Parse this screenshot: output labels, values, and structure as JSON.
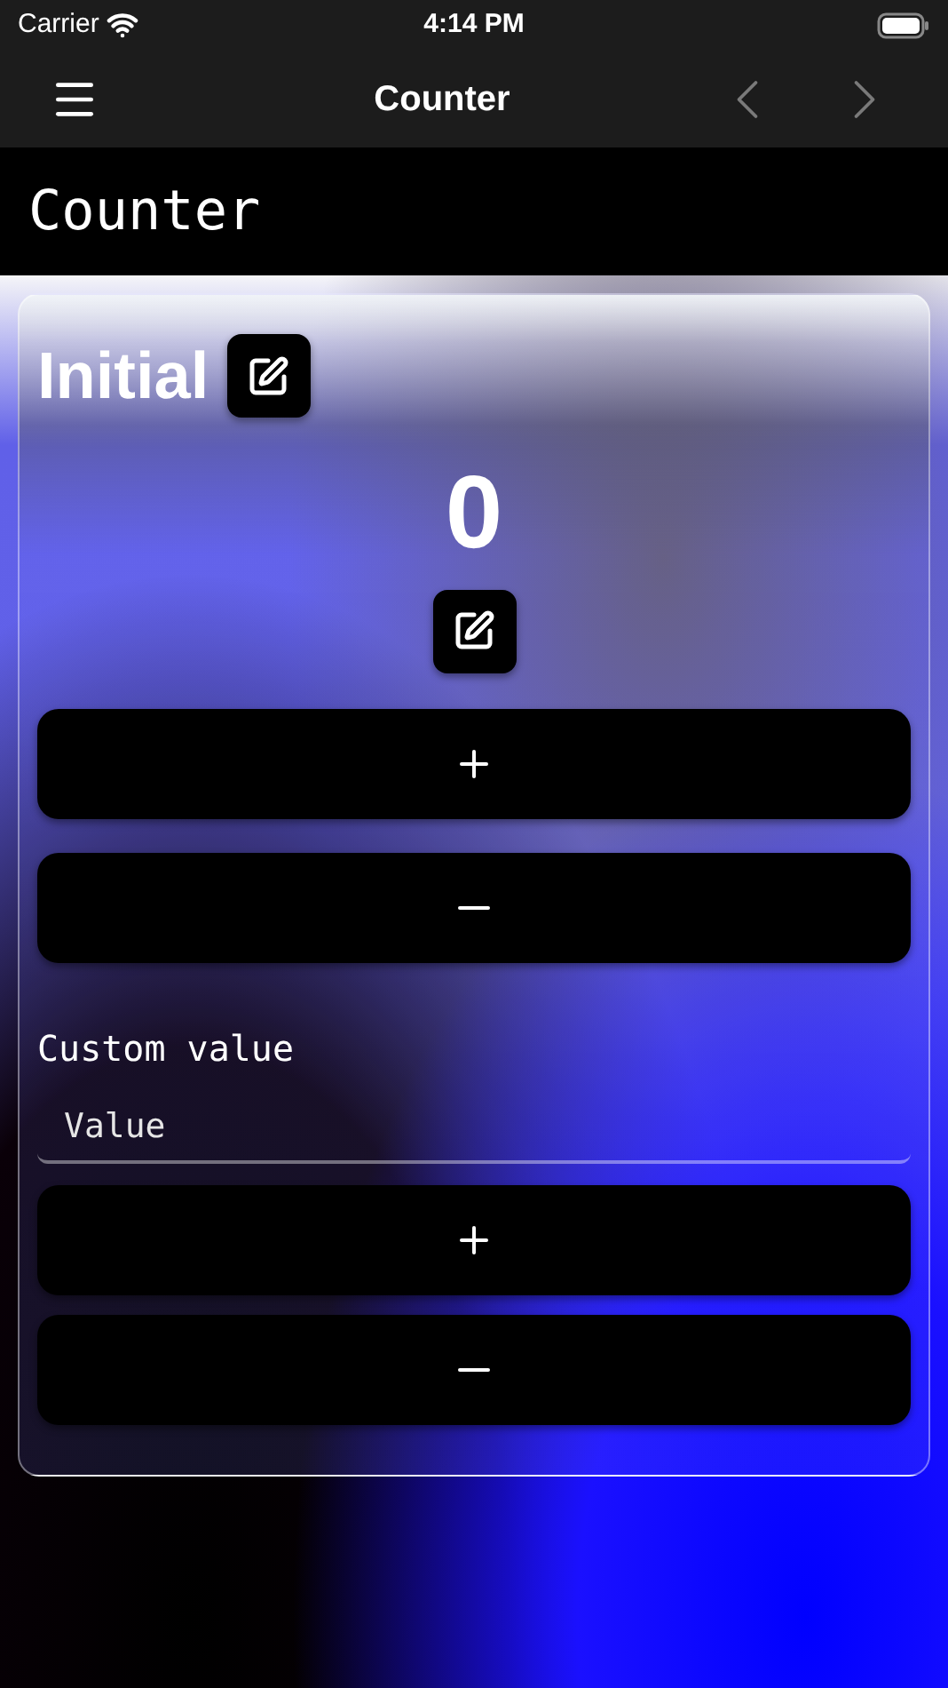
{
  "status_bar": {
    "carrier": "Carrier",
    "time": "4:14 PM"
  },
  "nav_bar": {
    "title": "Counter",
    "arrows": [
      {
        "kind": "back",
        "disabled": true
      },
      {
        "kind": "forward",
        "disabled": true
      }
    ]
  },
  "header": {
    "title": "Counter"
  },
  "card": {
    "title": "Initial",
    "count": "0",
    "custom_label": "Custom value",
    "value_field": {
      "placeholder": "Value"
    }
  }
}
